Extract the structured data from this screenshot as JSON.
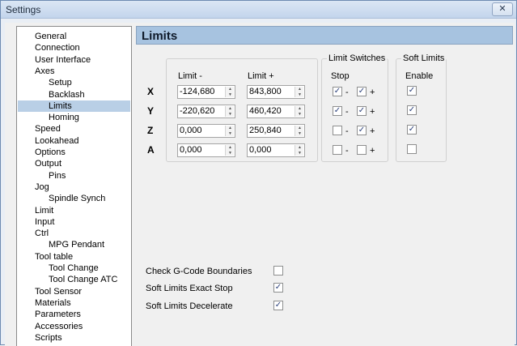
{
  "window": {
    "title": "Settings",
    "close_glyph": "✕"
  },
  "tree": [
    {
      "label": "General",
      "level": 0
    },
    {
      "label": "Connection",
      "level": 0
    },
    {
      "label": "User Interface",
      "level": 0
    },
    {
      "label": "Axes",
      "level": 0
    },
    {
      "label": "Setup",
      "level": 1
    },
    {
      "label": "Backlash",
      "level": 1
    },
    {
      "label": "Limits",
      "level": 1,
      "selected": true
    },
    {
      "label": "Homing",
      "level": 1
    },
    {
      "label": "Speed",
      "level": 0
    },
    {
      "label": "Lookahead",
      "level": 0
    },
    {
      "label": "Options",
      "level": 0
    },
    {
      "label": "Output",
      "level": 0
    },
    {
      "label": "Pins",
      "level": 1
    },
    {
      "label": "Jog",
      "level": 0
    },
    {
      "label": "Spindle Synch",
      "level": 1
    },
    {
      "label": "Limit",
      "level": 0
    },
    {
      "label": "Input",
      "level": 0
    },
    {
      "label": "Ctrl",
      "level": 0
    },
    {
      "label": "MPG Pendant",
      "level": 1
    },
    {
      "label": "Tool table",
      "level": 0
    },
    {
      "label": "Tool Change",
      "level": 1
    },
    {
      "label": "Tool Change ATC",
      "level": 1
    },
    {
      "label": "Tool Sensor",
      "level": 0
    },
    {
      "label": "Materials",
      "level": 0
    },
    {
      "label": "Parameters",
      "level": 0
    },
    {
      "label": "Accessories",
      "level": 0
    },
    {
      "label": "Scripts",
      "level": 0
    }
  ],
  "page": {
    "title": "Limits",
    "limit_minus_label": "Limit -",
    "limit_plus_label": "Limit +",
    "switches_group_label": "Limit Switches",
    "stop_label": "Stop",
    "soft_group_label": "Soft Limits",
    "enable_label": "Enable",
    "minus_sign": "-",
    "plus_sign": "+",
    "check_glyph": "✓",
    "axes": [
      {
        "name": "X",
        "limit_minus": "-124,680",
        "limit_plus": "843,800",
        "stop_minus": true,
        "stop_plus": true,
        "soft_enable": true
      },
      {
        "name": "Y",
        "limit_minus": "-220,620",
        "limit_plus": "460,420",
        "stop_minus": true,
        "stop_plus": true,
        "soft_enable": true
      },
      {
        "name": "Z",
        "limit_minus": "0,000",
        "limit_plus": "250,840",
        "stop_minus": false,
        "stop_plus": true,
        "soft_enable": true
      },
      {
        "name": "A",
        "limit_minus": "0,000",
        "limit_plus": "0,000",
        "stop_minus": false,
        "stop_plus": false,
        "soft_enable": false
      }
    ],
    "options": [
      {
        "label": "Check G-Code Boundaries",
        "checked": false
      },
      {
        "label": "Soft Limits Exact Stop",
        "checked": true
      },
      {
        "label": "Soft Limits Decelerate",
        "checked": true
      }
    ]
  },
  "colors": {
    "header": "#a7c3e0",
    "selection": "#b9cfe6"
  }
}
